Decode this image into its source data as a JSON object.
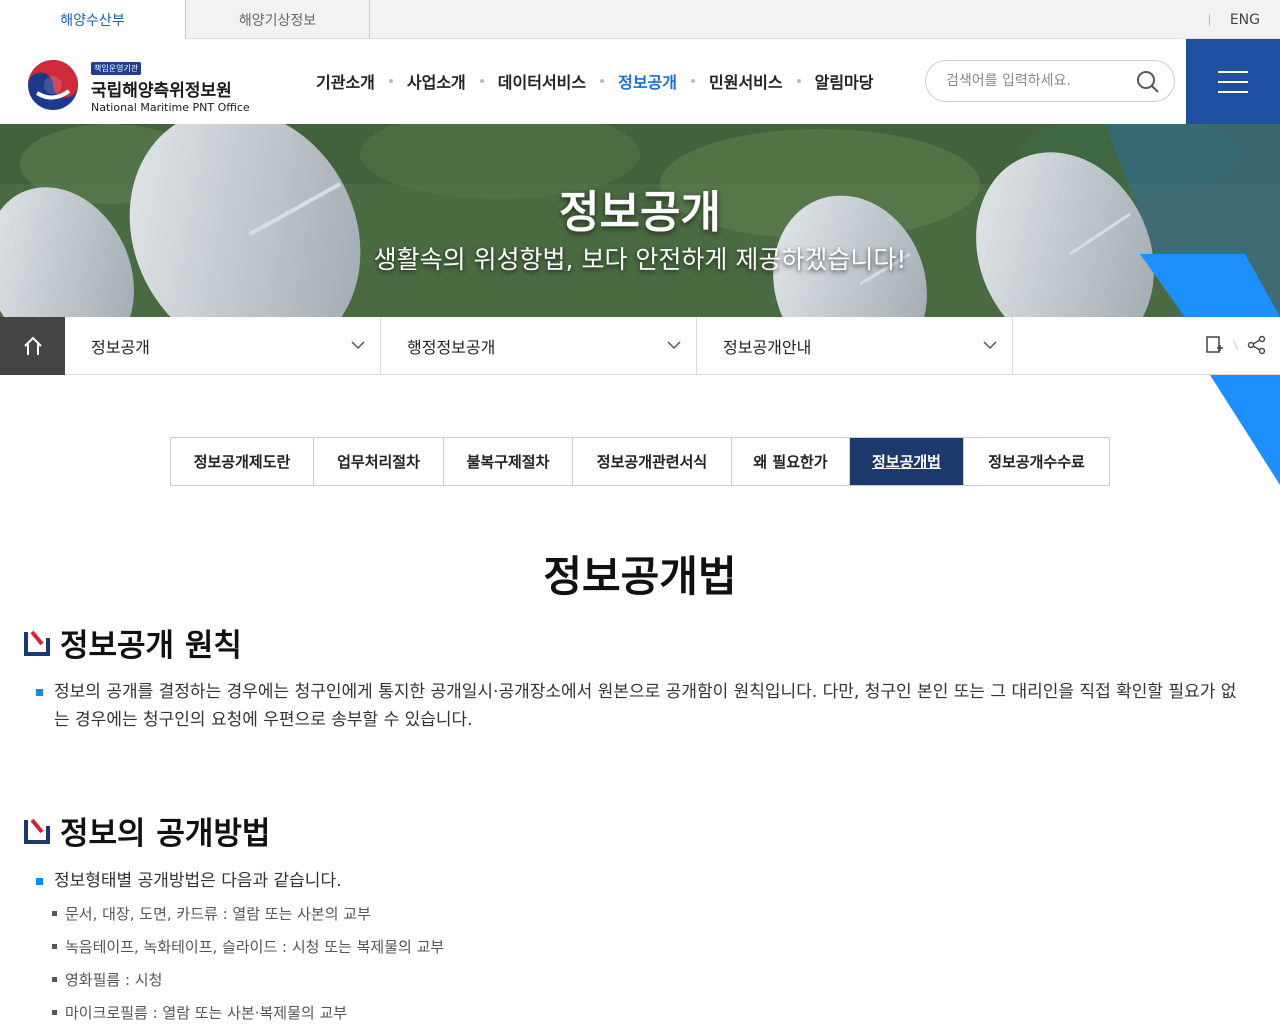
{
  "topbar": {
    "tabs": [
      "해양수산부",
      "해양기상정보"
    ],
    "lang": "ENG"
  },
  "logo": {
    "badge": "책임운영기관",
    "name_kr": "국립해양측위정보원",
    "name_en": "National Maritime PNT Office"
  },
  "gnb": {
    "items": [
      "기관소개",
      "사업소개",
      "데이터서비스",
      "정보공개",
      "민원서비스",
      "알림마당"
    ],
    "active_index": 3
  },
  "search": {
    "placeholder": "검색어를 입력하세요."
  },
  "hero": {
    "title": "정보공개",
    "subtitle": "생활속의 위성항법, 보다 안전하게 제공하겠습니다!"
  },
  "location": {
    "depth1": "정보공개",
    "depth2": "행정정보공개",
    "depth3": "정보공개안내"
  },
  "tabs": {
    "items": [
      "정보공개제도란",
      "업무처리절차",
      "불복구제절차",
      "정보공개관련서식",
      "왜 필요한가",
      "정보공개법",
      "정보공개수수료"
    ],
    "active_index": 5
  },
  "content": {
    "page_title": "정보공개법",
    "section1": {
      "title": "정보공개 원칙",
      "text": "정보의 공개를 결정하는 경우에는 청구인에게 통지한 공개일시·공개장소에서 원본으로 공개함이 원칙입니다. 다만, 청구인 본인 또는 그 대리인을 직접 확인할 필요가 없는 경우에는 청구인의 요청에 우편으로 송부할 수 있습니다."
    },
    "section2": {
      "title": "정보의 공개방법",
      "lead": "정보형태별 공개방법은 다음과 같습니다.",
      "items": [
        "문서, 대장, 도면, 카드류 : 열람 또는 사본의 교부",
        "녹음테이프, 녹화테이프, 슬라이드 : 시청 또는 복제물의 교부",
        "영화필름 : 시청",
        "마이크로필름 : 열람 또는 사본·복제물의 교부"
      ]
    }
  },
  "colors": {
    "primary": "#1f4fa0",
    "accent": "#1a6fd1",
    "tab_active": "#1b3a6b",
    "bullet": "#1a8ae0"
  }
}
